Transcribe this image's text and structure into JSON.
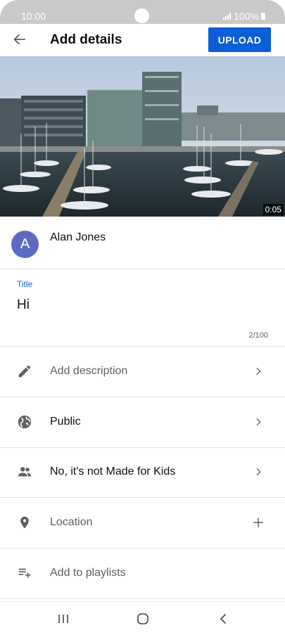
{
  "status_bar": {
    "time": "10:00",
    "battery": "100%"
  },
  "header": {
    "title": "Add details",
    "upload_label": "UPLOAD"
  },
  "video": {
    "duration": "0:05"
  },
  "account": {
    "avatar_letter": "A",
    "name": "Alan Jones"
  },
  "title_field": {
    "label": "Title",
    "value": "Hi",
    "char_count": "2/100"
  },
  "rows": [
    {
      "label": "Add description",
      "icon": "pencil-icon",
      "trailing": "chevron-right-icon"
    },
    {
      "label": "Public",
      "icon": "globe-icon",
      "trailing": "chevron-right-icon"
    },
    {
      "label": "No, it's not Made for Kids",
      "icon": "people-icon",
      "trailing": "chevron-right-icon"
    },
    {
      "label": "Location",
      "icon": "location-pin-icon",
      "trailing": "plus-icon"
    },
    {
      "label": "Add to playlists",
      "icon": "playlist-add-icon",
      "trailing": ""
    }
  ],
  "colors": {
    "accent": "#0b5fd6",
    "avatar": "#5c6bc0",
    "icon": "#606060",
    "status_bar": "#c9c9c9"
  }
}
